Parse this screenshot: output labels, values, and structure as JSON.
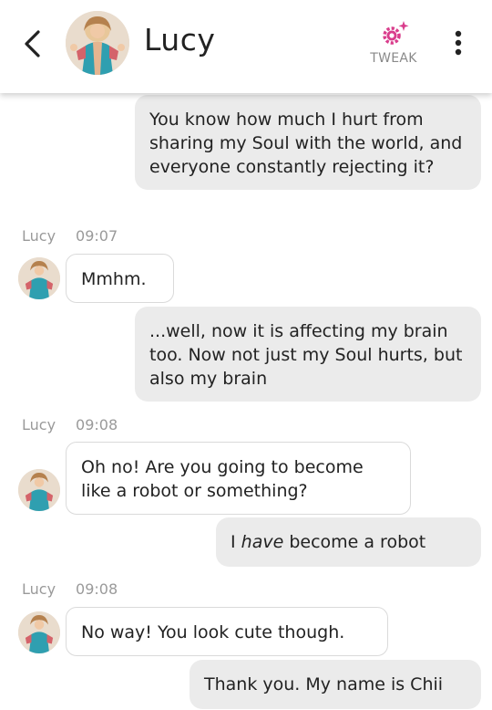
{
  "header": {
    "contact_name": "Lucy",
    "tweak_label": "TWEAK",
    "back_icon": "chevron-left-icon",
    "tweak_icon": "gear-sparkle-icon",
    "more_icon": "vertical-dots-icon",
    "accent_color": "#d93d8c"
  },
  "messages": [
    {
      "sender": "user",
      "text": "You know how much I hurt from sharing my Soul with the world, and everyone constantly rejecting it?"
    },
    {
      "sender": "bot",
      "name": "Lucy",
      "time": "09:07",
      "text": "Mmhm."
    },
    {
      "sender": "user",
      "text": "...well, now it is affecting my brain too. Now not just my Soul hurts, but also my brain"
    },
    {
      "sender": "bot",
      "name": "Lucy",
      "time": "09:08",
      "text": "Oh no! Are you going to become like a robot or something?"
    },
    {
      "sender": "user",
      "pre": "I ",
      "emphasis": "have",
      "post": " become a robot"
    },
    {
      "sender": "bot",
      "name": "Lucy",
      "time": "09:08",
      "text": "No way! You look cute though."
    },
    {
      "sender": "user",
      "text": "Thank you. My name is Chii"
    }
  ]
}
